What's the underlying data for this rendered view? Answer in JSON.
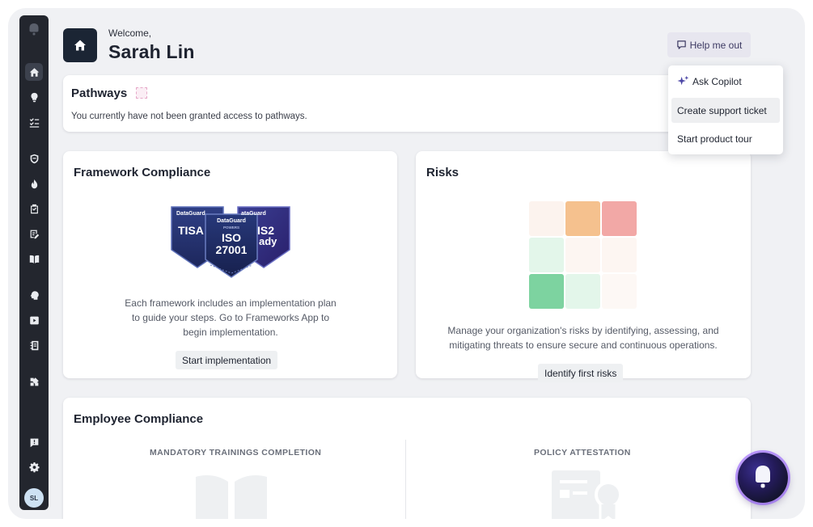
{
  "header": {
    "welcome": "Welcome,",
    "user_name": "Sarah Lin",
    "help_label": "Help me out"
  },
  "help_menu": {
    "items": [
      {
        "label": "Ask Copilot",
        "icon": "sparkle-icon"
      },
      {
        "label": "Create support ticket",
        "highlighted": true
      },
      {
        "label": "Start product tour"
      }
    ]
  },
  "sidebar": {
    "avatar_initials": "SL",
    "items": [
      {
        "icon": "home-icon",
        "active": true
      },
      {
        "icon": "lightbulb-icon"
      },
      {
        "icon": "checklist-icon"
      },
      {
        "icon": "shield-icon"
      },
      {
        "icon": "fire-icon"
      },
      {
        "icon": "clipboard-check-icon"
      },
      {
        "icon": "document-edit-icon"
      },
      {
        "icon": "book-icon"
      },
      {
        "icon": "brain-icon"
      },
      {
        "icon": "video-icon"
      },
      {
        "icon": "policy-icon"
      },
      {
        "icon": "apps-grid-icon"
      },
      {
        "icon": "feedback-icon"
      },
      {
        "icon": "settings-icon"
      }
    ]
  },
  "pathways": {
    "title": "Pathways",
    "message": "You currently have not been granted access to pathways."
  },
  "framework": {
    "title": "Framework Compliance",
    "badges": {
      "brand": "DataGuard",
      "powers": "POWERS",
      "left_text": "TISA",
      "center_line1": "ISO",
      "center_line2": "27001",
      "right_brand": "ataGuard",
      "right_line1": "IS2",
      "right_line2": "ady"
    },
    "description": "Each framework includes an implementation plan to guide your steps. Go to Frameworks App to begin implementation.",
    "button": "Start implementation"
  },
  "risks": {
    "title": "Risks",
    "description": "Manage your organization's risks by identifying, assessing, and mitigating threats to ensure secure and continuous operations.",
    "button": "Identify first risks",
    "colors": {
      "amber": "#f5c18e",
      "red": "#f2a8a6",
      "green": "#7dd3a0",
      "light_green": "#e3f6ea",
      "faint": "#fcf3ee"
    }
  },
  "employee": {
    "title": "Employee Compliance",
    "trainings_heading": "MANDATORY TRAININGS COMPLETION",
    "policy_heading": "POLICY ATTESTATION"
  }
}
